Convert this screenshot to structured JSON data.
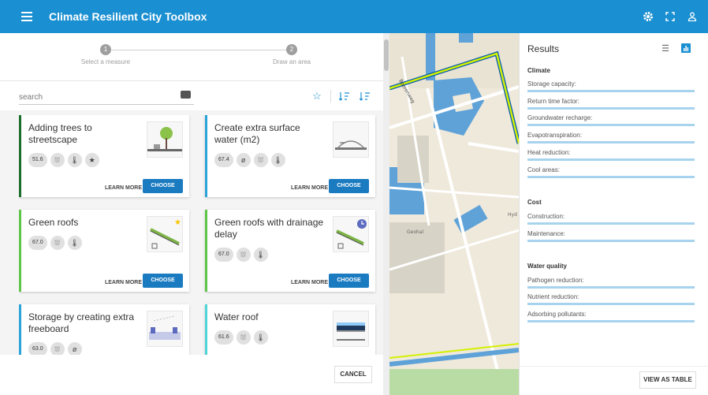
{
  "app": {
    "title": "Climate Resilient City Toolbox"
  },
  "stepper": {
    "steps": [
      {
        "num": "1",
        "label": "Select a measure"
      },
      {
        "num": "2",
        "label": "Draw an area"
      }
    ]
  },
  "search": {
    "placeholder": "search"
  },
  "measures": [
    {
      "title": "Adding trees to streetscape",
      "score": "51.6",
      "accent": "#1b6e2c"
    },
    {
      "title": "Create extra surface water (m2)",
      "score": "67.4",
      "accent": "#2aa3d8"
    },
    {
      "title": "Green roofs",
      "score": "67.0",
      "accent": "#5fc548"
    },
    {
      "title": "Green roofs with drainage delay",
      "score": "67.0",
      "accent": "#5fc548"
    },
    {
      "title": "Storage by creating extra freeboard",
      "score": "63.0",
      "accent": "#2aa3d8"
    },
    {
      "title": "Water roof",
      "score": "61.6",
      "accent": "#4fd4d8"
    }
  ],
  "card_actions": {
    "learn_more": "LEARN MORE",
    "choose": "CHOOSE"
  },
  "footer": {
    "cancel": "CANCEL"
  },
  "map": {
    "labels": {
      "street": "Boerenweg",
      "poi": "Geohal",
      "hyd": "Hyd"
    }
  },
  "results": {
    "title": "Results",
    "sections": [
      {
        "name": "Climate",
        "items": [
          "Storage capacity:",
          "Return time factor:",
          "Groundwater recharge:",
          "Evapotranspiration:",
          "Heat reduction:",
          "Cool areas:"
        ]
      },
      {
        "name": "Cost",
        "items": [
          "Construction:",
          "Maintenance:"
        ]
      },
      {
        "name": "Water quality",
        "items": [
          "Pathogen reduction:",
          "Nutrient reduction:",
          "Adsorbing pollutants:"
        ]
      }
    ],
    "view_table": "VIEW AS TABLE"
  },
  "colors": {
    "primary": "#1a8fd1",
    "bar": "#a7d3ee",
    "button": "#1a7bc1"
  }
}
